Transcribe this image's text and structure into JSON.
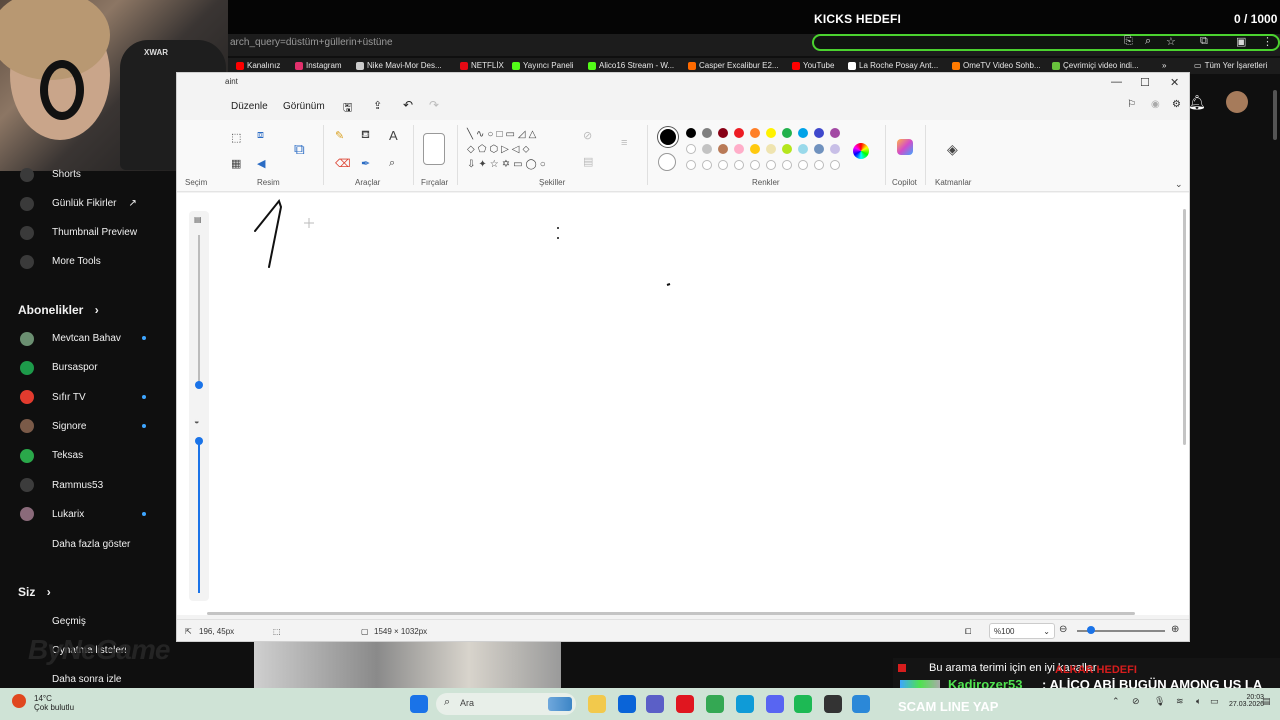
{
  "stream_overlay": {
    "goal_title": "KICKS HEDEFI",
    "goal_count": "0 / 1000",
    "watermark": "ByNeGame"
  },
  "browser": {
    "address_text": "arch_query=düstüm+güllerin+üstüne",
    "bookmarks": [
      {
        "label": "Kanalınız",
        "color": "#ff0000"
      },
      {
        "label": "Instagram",
        "color": "#e1306c"
      },
      {
        "label": "Nike Mavi-Mor Des...",
        "color": "#cccccc"
      },
      {
        "label": "NETFLİX",
        "color": "#e50914"
      },
      {
        "label": "Yayıncı Paneli",
        "color": "#53fc18"
      },
      {
        "label": "Alico16 Stream - W...",
        "color": "#53fc18"
      },
      {
        "label": "Casper Excalibur E2...",
        "color": "#ff6a00"
      },
      {
        "label": "YouTube",
        "color": "#ff0000"
      },
      {
        "label": "La Roche Posay Ant...",
        "color": "#ffffff"
      },
      {
        "label": "OmeTV Video Sohb...",
        "color": "#ff7a00"
      },
      {
        "label": "Çevrimiçi video indi...",
        "color": "#68c23c"
      }
    ],
    "bookmarks_more": "»",
    "all_bookmarks": "Tüm Yer İşaretleri"
  },
  "youtube_sidebar": {
    "top_items": [
      {
        "label": "Shorts",
        "icon": "shorts-icon"
      },
      {
        "label": "Günlük Fikirler",
        "icon": "lightbulb-icon",
        "external": "↗"
      },
      {
        "label": "Thumbnail Preview",
        "icon": "preview-icon"
      },
      {
        "label": "More Tools",
        "icon": "tools-icon"
      }
    ],
    "subs_heading": "Abonelikler",
    "subscriptions": [
      {
        "label": "Mevtcan Bahav",
        "color": "#6b8f71",
        "new": true
      },
      {
        "label": "Bursaspor",
        "color": "#1d9a4a",
        "new": false
      },
      {
        "label": "Sıfır TV",
        "color": "#e23b2e",
        "new": true
      },
      {
        "label": "Signore",
        "color": "#7a5a48",
        "new": true
      },
      {
        "label": "Teksas",
        "color": "#2aa84a",
        "new": false
      },
      {
        "label": "Rammus53",
        "color": "#3c3c3c",
        "new": false
      },
      {
        "label": "Lukarix",
        "color": "#8a6a7a",
        "new": true
      }
    ],
    "show_more": "Daha fazla göster",
    "you_heading": "Siz",
    "you_items": [
      {
        "label": "Geçmiş",
        "icon": "history-icon"
      },
      {
        "label": "Oynatma listeleri",
        "icon": "playlist-icon"
      },
      {
        "label": "Daha sonra izle",
        "icon": "clock-icon"
      }
    ]
  },
  "paint": {
    "title": "aint",
    "menu": [
      "Düzenle",
      "Görünüm"
    ],
    "groups": [
      "Seçim",
      "Resim",
      "Araçlar",
      "Fırçalar",
      "Şekiller",
      "Renkler",
      "Copilot",
      "Katmanlar"
    ],
    "colors_row1": [
      "#000000",
      "#7f7f7f",
      "#880015",
      "#ed1c24",
      "#ff7f27",
      "#fff200",
      "#22b14c",
      "#00a2e8",
      "#3f48cc",
      "#a349a4"
    ],
    "colors_row2": [
      "#ffffff",
      "#c3c3c3",
      "#b97a57",
      "#ffaec9",
      "#ffc90e",
      "#efe4b0",
      "#b5e61d",
      "#99d9ea",
      "#7092be",
      "#c8bfe7"
    ],
    "status": {
      "cursor_pos": "196, 45px",
      "canvas_size": "1549 × 1032px",
      "zoom": "%100"
    }
  },
  "chat": {
    "line1": "Bu arama terimi için en iyi kanallar",
    "line1_overlay": "ALKAR HEDEFI",
    "username": "Kadirozer53",
    "message": ": ALİCO ABİ BUGÜN AMONG US LA",
    "line3": "SCAM LINE YAP"
  },
  "taskbar": {
    "weather_temp": "14°C",
    "weather_desc": "Çok bulutlu",
    "search_placeholder": "Ara",
    "time": "20:03",
    "date": "27.03.2026",
    "apps": [
      {
        "name": "start-icon",
        "color": "#1a73e8"
      },
      {
        "name": "file-explorer-icon",
        "color": "#f2c94c"
      },
      {
        "name": "outlook-icon",
        "color": "#0a64d8"
      },
      {
        "name": "teams-icon",
        "color": "#5b5fc7"
      },
      {
        "name": "opera-icon",
        "color": "#e0161f"
      },
      {
        "name": "chrome-icon",
        "color": "#34a853"
      },
      {
        "name": "edge-icon",
        "color": "#0f9bd7"
      },
      {
        "name": "discord-icon",
        "color": "#5865f2"
      },
      {
        "name": "spotify-icon",
        "color": "#1db954"
      },
      {
        "name": "obs-icon",
        "color": "#333333"
      },
      {
        "name": "paint-icon",
        "color": "#2b88d8"
      }
    ]
  }
}
